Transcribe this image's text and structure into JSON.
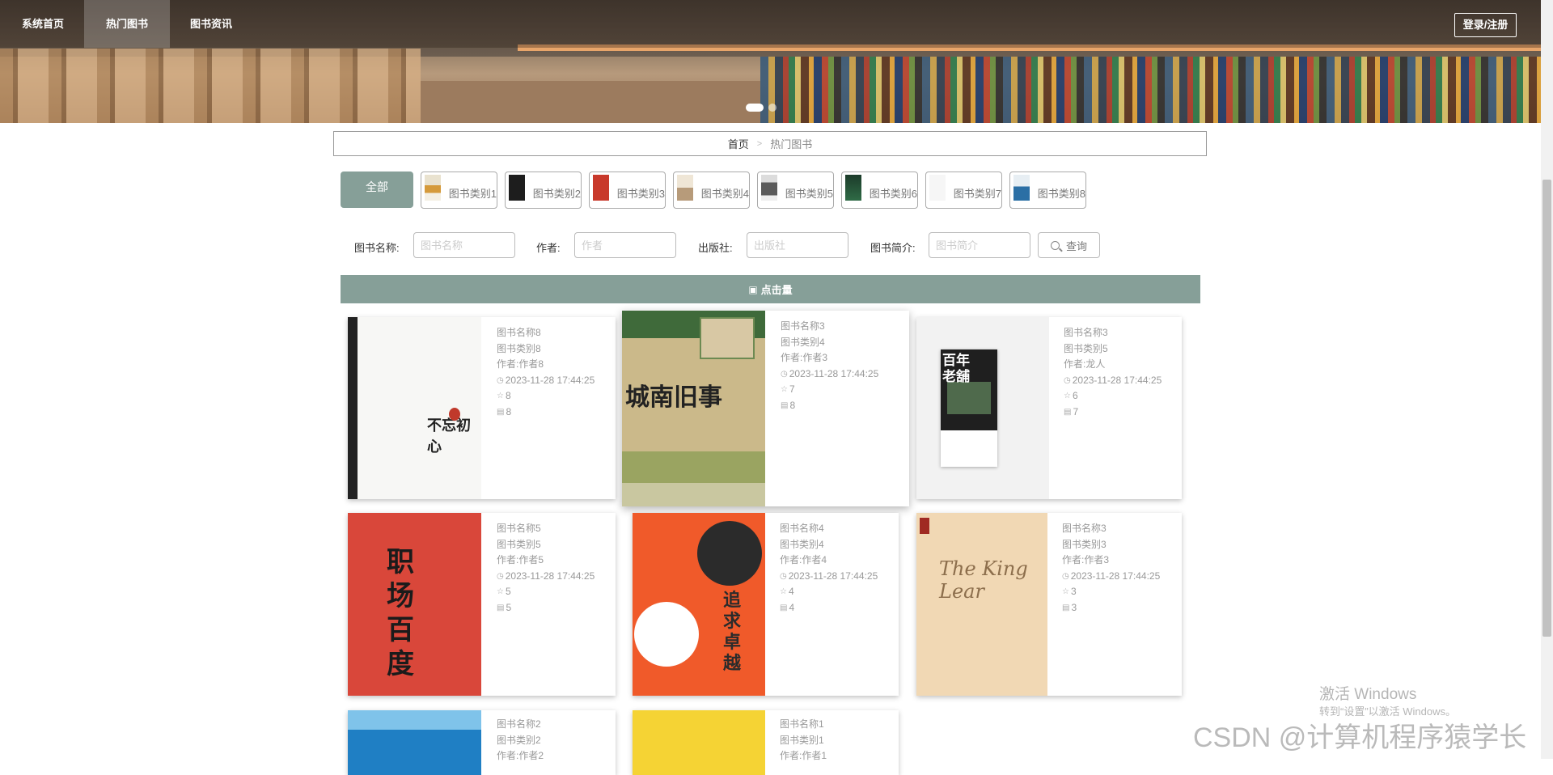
{
  "nav": {
    "items": [
      {
        "label": "系统首页",
        "active": false
      },
      {
        "label": "热门图书",
        "active": true
      },
      {
        "label": "图书资讯",
        "active": false
      }
    ],
    "login_label": "登录/注册"
  },
  "breadcrumb": {
    "home": "首页",
    "separator": ">",
    "current": "热门图书"
  },
  "categories": {
    "all_label": "全部",
    "items": [
      {
        "label": "图书类别1"
      },
      {
        "label": "图书类别2"
      },
      {
        "label": "图书类别3"
      },
      {
        "label": "图书类别4"
      },
      {
        "label": "图书类别5"
      },
      {
        "label": "图书类别6"
      },
      {
        "label": "图书类别7"
      },
      {
        "label": "图书类别8"
      }
    ]
  },
  "search": {
    "name_label": "图书名称:",
    "name_placeholder": "图书名称",
    "author_label": "作者:",
    "author_placeholder": "作者",
    "publisher_label": "出版社:",
    "publisher_placeholder": "出版社",
    "intro_label": "图书简介:",
    "intro_placeholder": "图书简介",
    "button_label": "查询"
  },
  "section": {
    "title": "点击量"
  },
  "books": [
    {
      "name": "图书名称8",
      "category": "图书类别8",
      "author": "作者:作者8",
      "time": "2023-11-28 17:44:25",
      "likes": "8",
      "views": "8",
      "cover_title": "不忘初心"
    },
    {
      "name": "图书名称3",
      "category": "图书类别4",
      "author": "作者:作者3",
      "time": "2023-11-28 17:44:25",
      "likes": "7",
      "views": "8",
      "cover_title": "城南旧事"
    },
    {
      "name": "图书名称3",
      "category": "图书类别5",
      "author": "作者:龙人",
      "time": "2023-11-28 17:44:25",
      "likes": "6",
      "views": "7",
      "cover_title": "百年老舖"
    },
    {
      "name": "图书名称5",
      "category": "图书类别5",
      "author": "作者:作者5",
      "time": "2023-11-28 17:44:25",
      "likes": "5",
      "views": "5",
      "cover_title": "职场百度"
    },
    {
      "name": "图书名称4",
      "category": "图书类别4",
      "author": "作者:作者4",
      "time": "2023-11-28 17:44:25",
      "likes": "4",
      "views": "4",
      "cover_title": "追求卓越"
    },
    {
      "name": "图书名称3",
      "category": "图书类别3",
      "author": "作者:作者3",
      "time": "2023-11-28 17:44:25",
      "likes": "3",
      "views": "3",
      "cover_title": "The King Lear"
    },
    {
      "name": "图书名称2",
      "category": "图书类别2",
      "author": "作者:作者2",
      "time": "",
      "likes": "",
      "views": "",
      "cover_title": ""
    },
    {
      "name": "图书名称1",
      "category": "图书类别1",
      "author": "作者:作者1",
      "time": "",
      "likes": "",
      "views": "",
      "cover_title": ""
    }
  ],
  "watermarks": {
    "activate_title": "激活 Windows",
    "activate_sub": "转到“设置”以激活 Windows。",
    "csdn": "CSDN @计算机程序猿学长"
  }
}
